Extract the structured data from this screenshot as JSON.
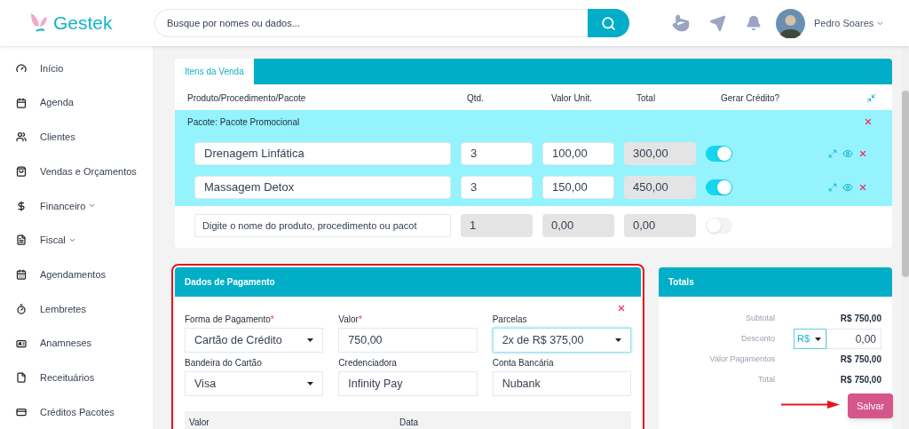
{
  "brand": {
    "name": "Gestek"
  },
  "search": {
    "placeholder": "Busque por nomes ou dados..."
  },
  "user": {
    "name": "Pedro Soares"
  },
  "sidebar": {
    "items": [
      {
        "label": "Início",
        "has_submenu": false
      },
      {
        "label": "Agenda",
        "has_submenu": false
      },
      {
        "label": "Clientes",
        "has_submenu": false
      },
      {
        "label": "Vendas e Orçamentos",
        "has_submenu": false
      },
      {
        "label": "Financeiro",
        "has_submenu": true
      },
      {
        "label": "Fiscal",
        "has_submenu": true
      },
      {
        "label": "Agendamentos",
        "has_submenu": false
      },
      {
        "label": "Lembretes",
        "has_submenu": false
      },
      {
        "label": "Anamneses",
        "has_submenu": false
      },
      {
        "label": "Receituários",
        "has_submenu": false
      },
      {
        "label": "Créditos Pacotes",
        "has_submenu": false
      }
    ]
  },
  "sale_items": {
    "tab": {
      "label": "Itens da Venda",
      "selected": true
    },
    "columns": [
      "Produto/Procedimento/Pacote",
      "Qtd.",
      "Valor Unit.",
      "Total",
      "Gerar Crédito?"
    ],
    "package": {
      "label": "Pacote: Pacote Promocional",
      "items": [
        {
          "name": "Drenagem Linfática",
          "qty": "3",
          "unit": "100,00",
          "total": "300,00",
          "credit": true
        },
        {
          "name": "Massagem Detox",
          "qty": "3",
          "unit": "150,00",
          "total": "450,00",
          "credit": true
        }
      ]
    },
    "new_item": {
      "placeholder": "Digite o nome do produto, procedimento ou pacot",
      "qty": "1",
      "unit": "0,00",
      "total": "0,00",
      "credit": false,
      "disabled": true
    }
  },
  "payment": {
    "title": "Dados de Pagamento",
    "highlighted": true,
    "fields": [
      {
        "label": "Forma de Pagamento",
        "required_mark": "*",
        "kind": "select",
        "value": "Cartão de Crédito",
        "focused": false
      },
      {
        "label": "Valor",
        "required_mark": "*",
        "kind": "input",
        "value": "750,00",
        "focused": false
      },
      {
        "label": "Parcelas",
        "kind": "select",
        "value": "2x de R$ 375,00",
        "focused": true
      },
      {
        "label": "Bandeira do Cartão",
        "kind": "select",
        "value": "Visa",
        "focused": false
      },
      {
        "label": "Credenciadora",
        "kind": "input",
        "value": "Infinity Pay",
        "focused": false
      },
      {
        "label": "Conta Bancária",
        "kind": "input",
        "value": "Nubank",
        "focused": false
      }
    ],
    "table_columns": [
      "Valor",
      "Data"
    ]
  },
  "totals": {
    "title": "Totals",
    "rows": [
      {
        "kind": "text",
        "label": "Subtotal",
        "value": "R$ 750,00"
      },
      {
        "kind": "discount",
        "label": "Desconto",
        "currency": "R$",
        "value": "0,00"
      },
      {
        "kind": "text",
        "label": "Valor Pagamentos",
        "value": "R$ 750,00"
      },
      {
        "kind": "text",
        "label": "Total",
        "value": "R$ 750,00"
      }
    ]
  },
  "save_button": {
    "label": "Salvar"
  }
}
